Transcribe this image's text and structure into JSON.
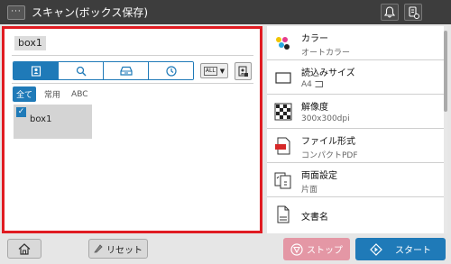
{
  "header": {
    "menu_label": "···",
    "title": "スキャン(ボックス保存)"
  },
  "left": {
    "box_name": "box1",
    "tabs": [
      "user-box-icon",
      "search-icon",
      "tray-icon",
      "clock-icon"
    ],
    "view_label": "ALL",
    "filters": [
      "全て",
      "常用",
      "ABC"
    ],
    "boxes": [
      {
        "name": "box1",
        "selected": true
      }
    ]
  },
  "settings": [
    {
      "icon": "color-icon",
      "label": "カラー",
      "value": "オートカラー"
    },
    {
      "icon": "paper-size-icon",
      "label": "読込みサイズ",
      "value": "A4"
    },
    {
      "icon": "resolution-icon",
      "label": "解像度",
      "value": "300x300dpi"
    },
    {
      "icon": "pdf-file-icon",
      "label": "ファイル形式",
      "value": "コンパクトPDF"
    },
    {
      "icon": "duplex-icon",
      "label": "両面設定",
      "value": "片面"
    },
    {
      "icon": "document-name-icon",
      "label": "文書名",
      "value": ""
    }
  ],
  "footer": {
    "reset_label": "リセット",
    "stop_label": "ストップ",
    "start_label": "スタート"
  },
  "colors": {
    "accent": "#1f7ab8",
    "highlight": "#e01c22",
    "stop": "#e497a5"
  }
}
